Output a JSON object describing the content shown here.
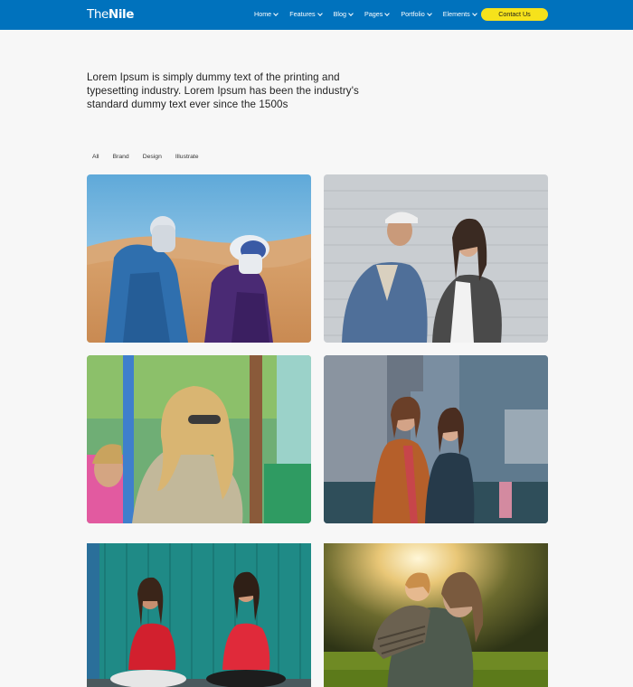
{
  "header": {
    "logo_light": "The",
    "logo_bold": "Nile",
    "nav": [
      {
        "label": "Home"
      },
      {
        "label": "Features"
      },
      {
        "label": "Blog"
      },
      {
        "label": "Pages"
      },
      {
        "label": "Portfolio"
      },
      {
        "label": "Elements"
      }
    ],
    "contact_label": "Contact Us"
  },
  "intro": {
    "text": "Lorem Ipsum is simply dummy text of the printing and typesetting industry. Lorem Ipsum has been the industry's standard dummy text ever since the 1500s"
  },
  "filters": [
    "All",
    "Brand",
    "Design",
    "Illustrate"
  ],
  "gallery": [
    {
      "subject": "desert-travelers"
    },
    {
      "subject": "couple-brick-wall"
    },
    {
      "subject": "woman-sunglasses"
    },
    {
      "subject": "women-city-street"
    },
    {
      "subject": "girls-sitting"
    },
    {
      "subject": "sunset-piggyback"
    }
  ],
  "colors": {
    "header": "#0072bd",
    "contact_button": "#f6e21b",
    "background": "#f7f7f7"
  }
}
